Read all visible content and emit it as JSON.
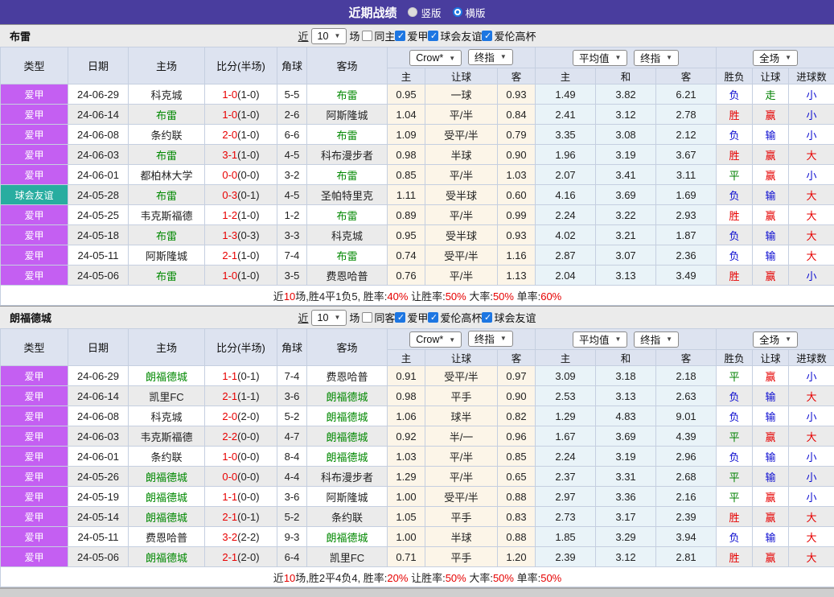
{
  "titlebar": {
    "title": "近期战绩",
    "radios": [
      {
        "label": "竖版",
        "selected": false
      },
      {
        "label": "横版",
        "selected": true
      }
    ]
  },
  "selectors": {
    "company": "Crow*",
    "company_mode": "终指",
    "avg": "平均值",
    "avg_mode": "终指",
    "scope": "全场"
  },
  "table_headers": {
    "type": "类型",
    "date": "日期",
    "home": "主场",
    "score": "比分(半场)",
    "corner": "角球",
    "away": "客场",
    "odds_sub": [
      "主",
      "让球",
      "客"
    ],
    "avg_sub": [
      "主",
      "和",
      "客"
    ],
    "result_sub": [
      "胜负",
      "让球",
      "进球数"
    ]
  },
  "colors": {
    "type_styles": {
      "爱甲": "#c45ff2",
      "球会友谊": "#28ada0"
    },
    "verdict": {
      "胜": "#e60000",
      "赢": "#e60000",
      "大": "#e60000",
      "负": "#0b0bd0",
      "输": "#0b0bd0",
      "小": "#0b0bd0",
      "平": "#008000",
      "走": "#008000"
    },
    "team_highlight": "#008800",
    "titlebar_bg": "#493d9e"
  },
  "sections": [
    {
      "team": "布雷",
      "filters": {
        "near_label": "近",
        "games_value": "10",
        "games_label": "场",
        "checks": [
          {
            "label": "同主",
            "checked": false
          },
          {
            "label": "爱甲",
            "checked": true
          },
          {
            "label": "球会友谊",
            "checked": true
          },
          {
            "label": "爱伦高杯",
            "checked": true
          }
        ]
      },
      "rows": [
        {
          "type": "爱甲",
          "date": "24-06-29",
          "home": "科克城",
          "ft": "1-0",
          "ht": "(1-0)",
          "corner": "5-5",
          "away": "布雷",
          "o_home": "0.95",
          "line": "一球",
          "o_away": "0.93",
          "avg_home": "1.49",
          "avg_draw": "3.82",
          "avg_away": "6.21",
          "r_wdl": "负",
          "r_let": "走",
          "r_goal": "小"
        },
        {
          "type": "爱甲",
          "date": "24-06-14",
          "home": "布雷",
          "ft": "1-0",
          "ht": "(1-0)",
          "corner": "2-6",
          "away": "阿斯隆城",
          "o_home": "1.04",
          "line": "平/半",
          "o_away": "0.84",
          "avg_home": "2.41",
          "avg_draw": "3.12",
          "avg_away": "2.78",
          "r_wdl": "胜",
          "r_let": "赢",
          "r_goal": "小"
        },
        {
          "type": "爱甲",
          "date": "24-06-08",
          "home": "条约联",
          "ft": "2-0",
          "ht": "(1-0)",
          "corner": "6-6",
          "away": "布雷",
          "o_home": "1.09",
          "line": "受平/半",
          "o_away": "0.79",
          "avg_home": "3.35",
          "avg_draw": "3.08",
          "avg_away": "2.12",
          "r_wdl": "负",
          "r_let": "输",
          "r_goal": "小"
        },
        {
          "type": "爱甲",
          "date": "24-06-03",
          "home": "布雷",
          "ft": "3-1",
          "ht": "(1-0)",
          "corner": "4-5",
          "away": "科布漫步者",
          "o_home": "0.98",
          "line": "半球",
          "o_away": "0.90",
          "avg_home": "1.96",
          "avg_draw": "3.19",
          "avg_away": "3.67",
          "r_wdl": "胜",
          "r_let": "赢",
          "r_goal": "大"
        },
        {
          "type": "爱甲",
          "date": "24-06-01",
          "home": "都柏林大学",
          "ft": "0-0",
          "ht": "(0-0)",
          "corner": "3-2",
          "away": "布雷",
          "o_home": "0.85",
          "line": "平/半",
          "o_away": "1.03",
          "avg_home": "2.07",
          "avg_draw": "3.41",
          "avg_away": "3.11",
          "r_wdl": "平",
          "r_let": "赢",
          "r_goal": "小"
        },
        {
          "type": "球会友谊",
          "date": "24-05-28",
          "home": "布雷",
          "ft": "0-3",
          "ht": "(0-1)",
          "corner": "4-5",
          "away": "圣帕特里克",
          "o_home": "1.11",
          "line": "受半球",
          "o_away": "0.60",
          "avg_home": "4.16",
          "avg_draw": "3.69",
          "avg_away": "1.69",
          "r_wdl": "负",
          "r_let": "输",
          "r_goal": "大"
        },
        {
          "type": "爱甲",
          "date": "24-05-25",
          "home": "韦克斯福德",
          "ft": "1-2",
          "ht": "(1-0)",
          "corner": "1-2",
          "away": "布雷",
          "o_home": "0.89",
          "line": "平/半",
          "o_away": "0.99",
          "avg_home": "2.24",
          "avg_draw": "3.22",
          "avg_away": "2.93",
          "r_wdl": "胜",
          "r_let": "赢",
          "r_goal": "大"
        },
        {
          "type": "爱甲",
          "date": "24-05-18",
          "home": "布雷",
          "ft": "1-3",
          "ht": "(0-3)",
          "corner": "3-3",
          "away": "科克城",
          "o_home": "0.95",
          "line": "受半球",
          "o_away": "0.93",
          "avg_home": "4.02",
          "avg_draw": "3.21",
          "avg_away": "1.87",
          "r_wdl": "负",
          "r_let": "输",
          "r_goal": "大"
        },
        {
          "type": "爱甲",
          "date": "24-05-11",
          "home": "阿斯隆城",
          "ft": "2-1",
          "ht": "(1-0)",
          "corner": "7-4",
          "away": "布雷",
          "o_home": "0.74",
          "line": "受平/半",
          "o_away": "1.16",
          "avg_home": "2.87",
          "avg_draw": "3.07",
          "avg_away": "2.36",
          "r_wdl": "负",
          "r_let": "输",
          "r_goal": "大"
        },
        {
          "type": "爱甲",
          "date": "24-05-06",
          "home": "布雷",
          "ft": "1-0",
          "ht": "(1-0)",
          "corner": "3-5",
          "away": "费恩哈普",
          "o_home": "0.76",
          "line": "平/半",
          "o_away": "1.13",
          "avg_home": "2.04",
          "avg_draw": "3.13",
          "avg_away": "3.49",
          "r_wdl": "胜",
          "r_let": "赢",
          "r_goal": "小"
        }
      ],
      "summary": [
        {
          "text": "近",
          "color": "#222"
        },
        {
          "text": "10",
          "color": "#e60000"
        },
        {
          "text": "场,胜4平1负5, 胜率:",
          "color": "#222"
        },
        {
          "text": "40%",
          "color": "#e60000"
        },
        {
          "text": " 让胜率:",
          "color": "#222"
        },
        {
          "text": "50%",
          "color": "#e60000"
        },
        {
          "text": " 大率:",
          "color": "#222"
        },
        {
          "text": "50%",
          "color": "#e60000"
        },
        {
          "text": " 单率:",
          "color": "#222"
        },
        {
          "text": "60%",
          "color": "#e60000"
        }
      ]
    },
    {
      "team": "朗福德城",
      "filters": {
        "near_label": "近",
        "games_value": "10",
        "games_label": "场",
        "checks": [
          {
            "label": "同客",
            "checked": false
          },
          {
            "label": "爱甲",
            "checked": true
          },
          {
            "label": "爱伦高杯",
            "checked": true
          },
          {
            "label": "球会友谊",
            "checked": true
          }
        ]
      },
      "rows": [
        {
          "type": "爱甲",
          "date": "24-06-29",
          "home": "朗福德城",
          "ft": "1-1",
          "ht": "(0-1)",
          "corner": "7-4",
          "away": "费恩哈普",
          "o_home": "0.91",
          "line": "受平/半",
          "o_away": "0.97",
          "avg_home": "3.09",
          "avg_draw": "3.18",
          "avg_away": "2.18",
          "r_wdl": "平",
          "r_let": "赢",
          "r_goal": "小"
        },
        {
          "type": "爱甲",
          "date": "24-06-14",
          "home": "凯里FC",
          "ft": "2-1",
          "ht": "(1-1)",
          "corner": "3-6",
          "away": "朗福德城",
          "o_home": "0.98",
          "line": "平手",
          "o_away": "0.90",
          "avg_home": "2.53",
          "avg_draw": "3.13",
          "avg_away": "2.63",
          "r_wdl": "负",
          "r_let": "输",
          "r_goal": "大"
        },
        {
          "type": "爱甲",
          "date": "24-06-08",
          "home": "科克城",
          "ft": "2-0",
          "ht": "(2-0)",
          "corner": "5-2",
          "away": "朗福德城",
          "o_home": "1.06",
          "line": "球半",
          "o_away": "0.82",
          "avg_home": "1.29",
          "avg_draw": "4.83",
          "avg_away": "9.01",
          "r_wdl": "负",
          "r_let": "输",
          "r_goal": "小"
        },
        {
          "type": "爱甲",
          "date": "24-06-03",
          "home": "韦克斯福德",
          "ft": "2-2",
          "ht": "(0-0)",
          "corner": "4-7",
          "away": "朗福德城",
          "o_home": "0.92",
          "line": "半/一",
          "o_away": "0.96",
          "avg_home": "1.67",
          "avg_draw": "3.69",
          "avg_away": "4.39",
          "r_wdl": "平",
          "r_let": "赢",
          "r_goal": "大"
        },
        {
          "type": "爱甲",
          "date": "24-06-01",
          "home": "条约联",
          "ft": "1-0",
          "ht": "(0-0)",
          "corner": "8-4",
          "away": "朗福德城",
          "o_home": "1.03",
          "line": "平/半",
          "o_away": "0.85",
          "avg_home": "2.24",
          "avg_draw": "3.19",
          "avg_away": "2.96",
          "r_wdl": "负",
          "r_let": "输",
          "r_goal": "小"
        },
        {
          "type": "爱甲",
          "date": "24-05-26",
          "home": "朗福德城",
          "ft": "0-0",
          "ht": "(0-0)",
          "corner": "4-4",
          "away": "科布漫步者",
          "o_home": "1.29",
          "line": "平/半",
          "o_away": "0.65",
          "avg_home": "2.37",
          "avg_draw": "3.31",
          "avg_away": "2.68",
          "r_wdl": "平",
          "r_let": "输",
          "r_goal": "小"
        },
        {
          "type": "爱甲",
          "date": "24-05-19",
          "home": "朗福德城",
          "ft": "1-1",
          "ht": "(0-0)",
          "corner": "3-6",
          "away": "阿斯隆城",
          "o_home": "1.00",
          "line": "受平/半",
          "o_away": "0.88",
          "avg_home": "2.97",
          "avg_draw": "3.36",
          "avg_away": "2.16",
          "r_wdl": "平",
          "r_let": "赢",
          "r_goal": "小"
        },
        {
          "type": "爱甲",
          "date": "24-05-14",
          "home": "朗福德城",
          "ft": "2-1",
          "ht": "(0-1)",
          "corner": "5-2",
          "away": "条约联",
          "o_home": "1.05",
          "line": "平手",
          "o_away": "0.83",
          "avg_home": "2.73",
          "avg_draw": "3.17",
          "avg_away": "2.39",
          "r_wdl": "胜",
          "r_let": "赢",
          "r_goal": "大"
        },
        {
          "type": "爱甲",
          "date": "24-05-11",
          "home": "费恩哈普",
          "ft": "3-2",
          "ht": "(2-2)",
          "corner": "9-3",
          "away": "朗福德城",
          "o_home": "1.00",
          "line": "半球",
          "o_away": "0.88",
          "avg_home": "1.85",
          "avg_draw": "3.29",
          "avg_away": "3.94",
          "r_wdl": "负",
          "r_let": "输",
          "r_goal": "大"
        },
        {
          "type": "爱甲",
          "date": "24-05-06",
          "home": "朗福德城",
          "ft": "2-1",
          "ht": "(2-0)",
          "corner": "6-4",
          "away": "凯里FC",
          "o_home": "0.71",
          "line": "平手",
          "o_away": "1.20",
          "avg_home": "2.39",
          "avg_draw": "3.12",
          "avg_away": "2.81",
          "r_wdl": "胜",
          "r_let": "赢",
          "r_goal": "大"
        }
      ],
      "summary": [
        {
          "text": "近",
          "color": "#222"
        },
        {
          "text": "10",
          "color": "#e60000"
        },
        {
          "text": "场,胜2平4负4, 胜率:",
          "color": "#222"
        },
        {
          "text": "20%",
          "color": "#e60000"
        },
        {
          "text": " 让胜率:",
          "color": "#222"
        },
        {
          "text": "50%",
          "color": "#e60000"
        },
        {
          "text": " 大率:",
          "color": "#222"
        },
        {
          "text": "50%",
          "color": "#e60000"
        },
        {
          "text": " 单率:",
          "color": "#222"
        },
        {
          "text": "50%",
          "color": "#e60000"
        }
      ]
    }
  ]
}
